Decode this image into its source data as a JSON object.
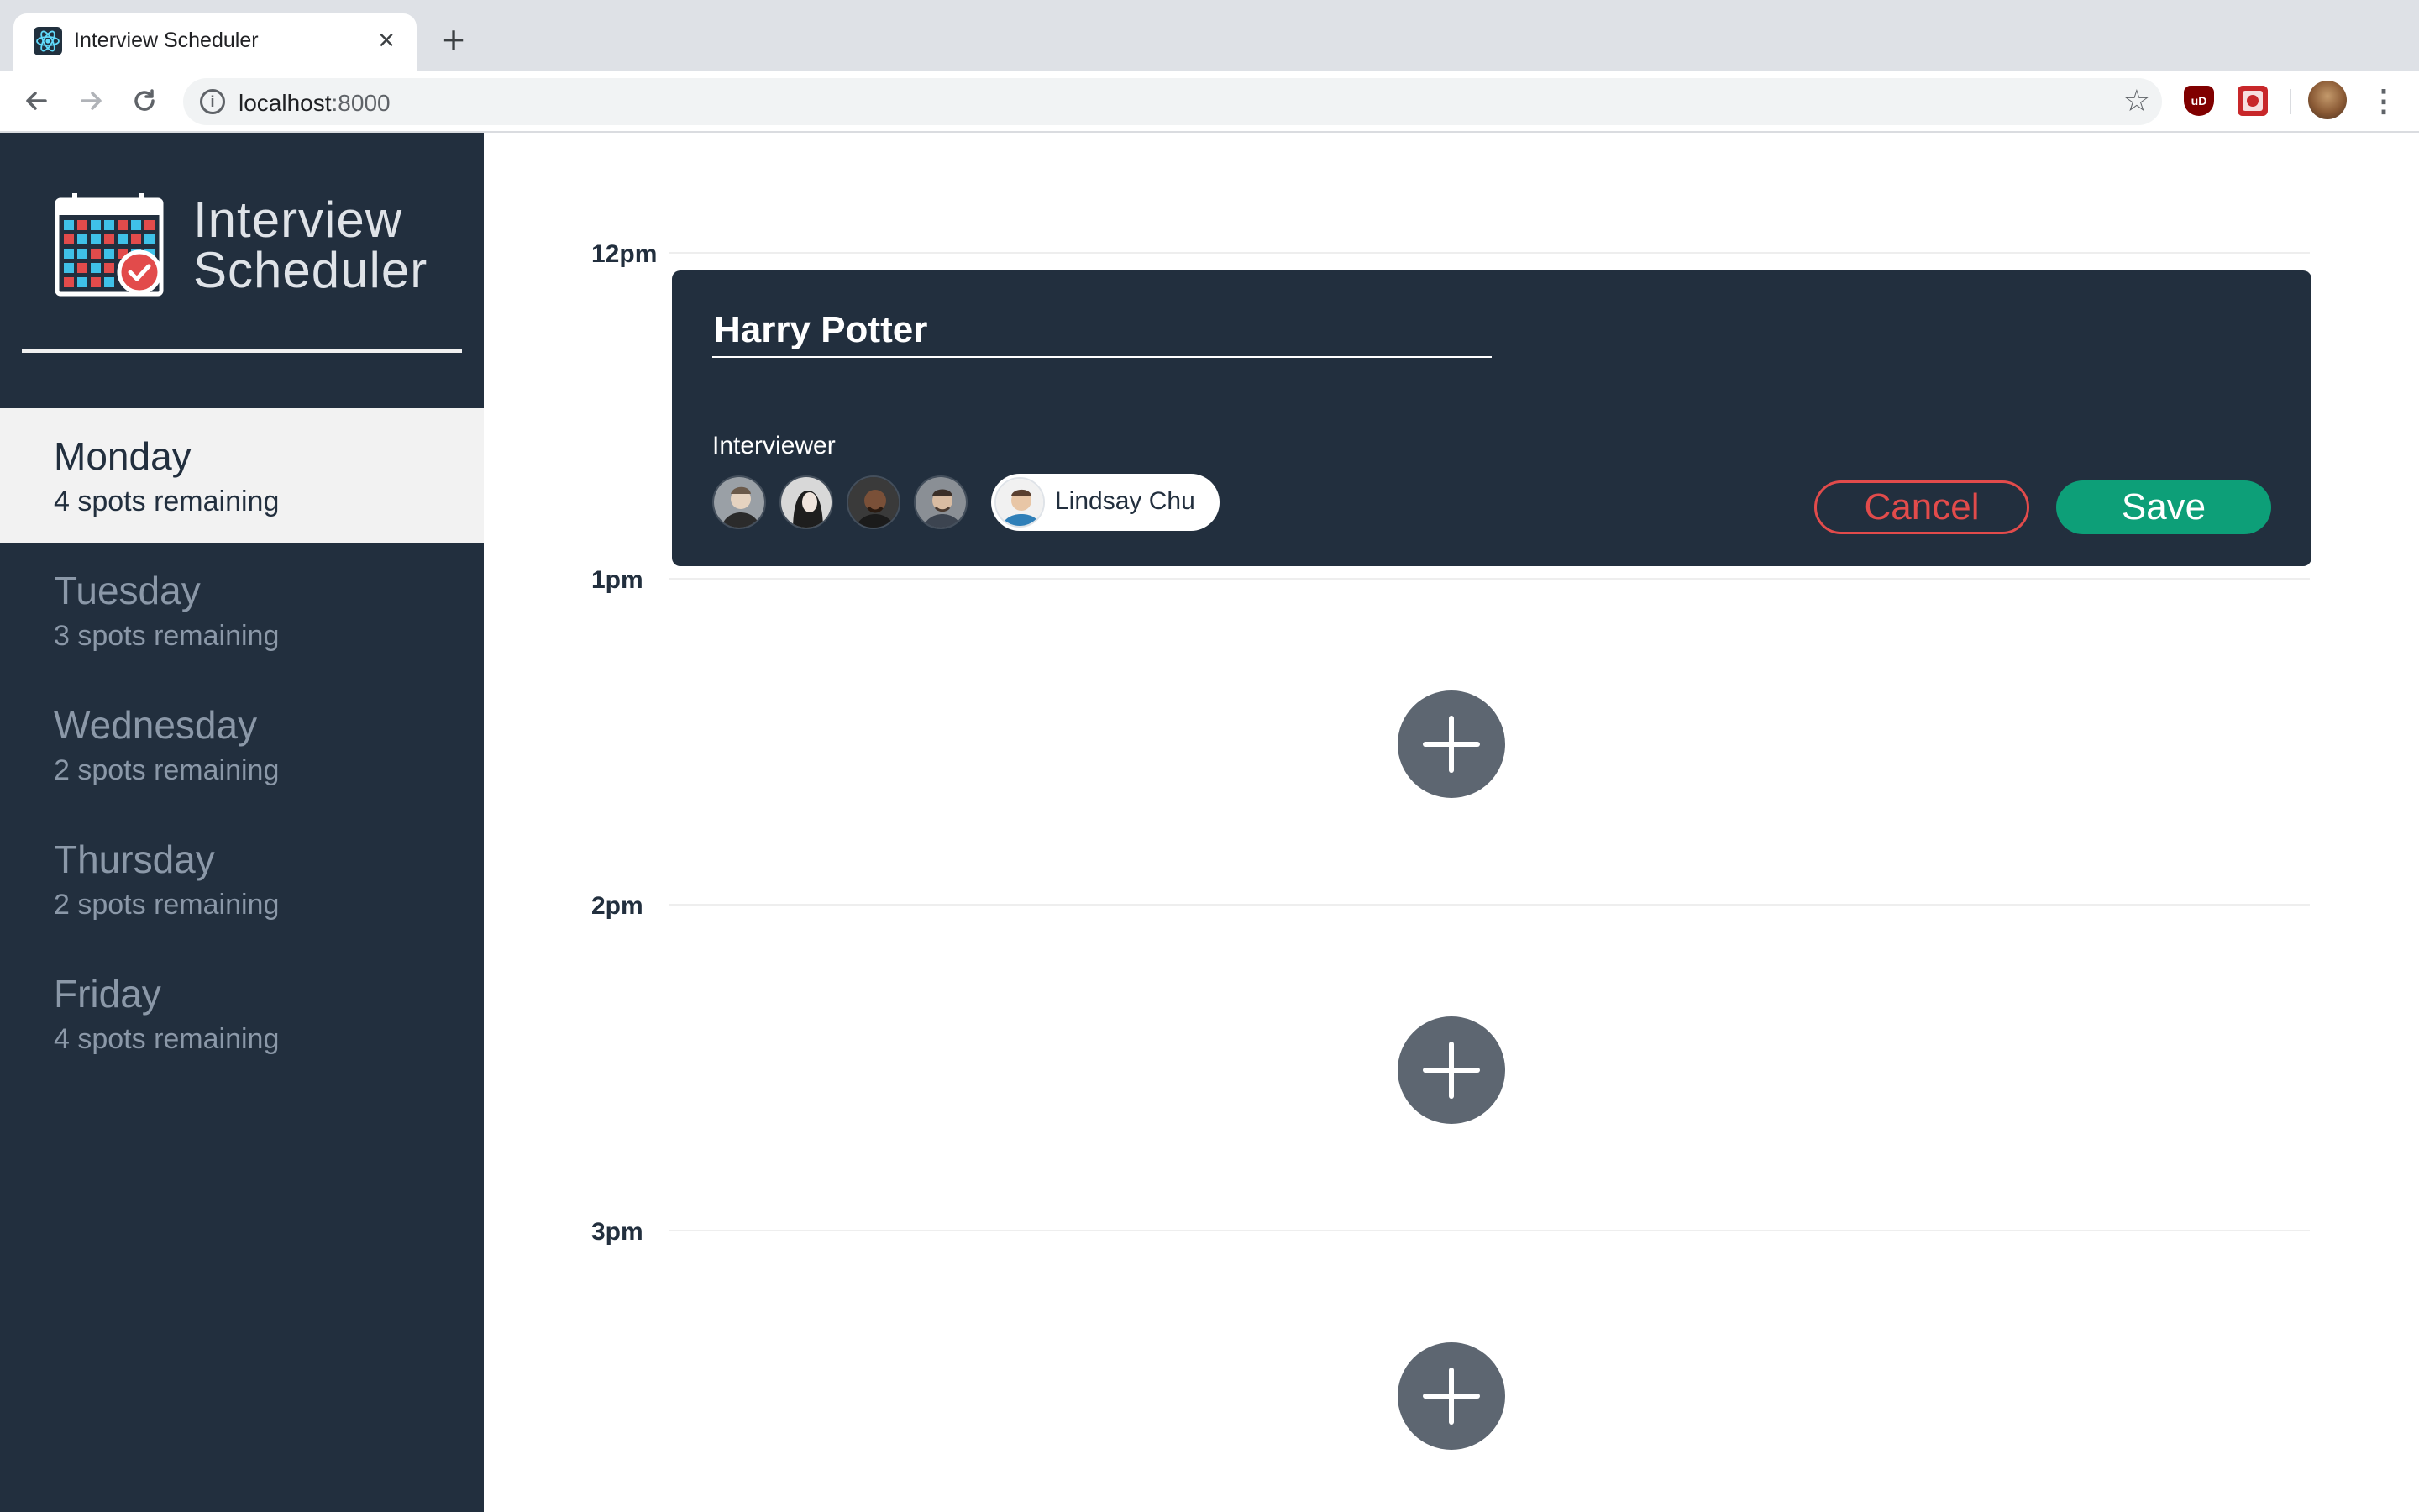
{
  "browser": {
    "tab_title": "Interview Scheduler",
    "tab_close": "×",
    "new_tab": "+",
    "url_host": "localhost",
    "url_port": ":8000",
    "ext_ub": "uD"
  },
  "app": {
    "brand_line1": "Interview",
    "brand_line2": "Scheduler",
    "logo_icon": "calendar-check-icon"
  },
  "sidebar": {
    "days": [
      {
        "name": "Monday",
        "spots": "4 spots remaining",
        "selected": true
      },
      {
        "name": "Tuesday",
        "spots": "3 spots remaining",
        "selected": false
      },
      {
        "name": "Wednesday",
        "spots": "2 spots remaining",
        "selected": false
      },
      {
        "name": "Thursday",
        "spots": "2 spots remaining",
        "selected": false
      },
      {
        "name": "Friday",
        "spots": "4 spots remaining",
        "selected": false
      }
    ]
  },
  "schedule": {
    "times": [
      "12pm",
      "1pm",
      "2pm",
      "3pm"
    ],
    "form": {
      "student_name": "Harry Potter",
      "interviewer_label": "Interviewer",
      "selected_interviewer": "Lindsay Chu",
      "cancel_label": "Cancel",
      "save_label": "Save"
    }
  },
  "colors": {
    "sidebar_bg": "#222f3e",
    "cancel": "#e24b4b",
    "save": "#0d9f78",
    "add_button": "#5d6671"
  }
}
